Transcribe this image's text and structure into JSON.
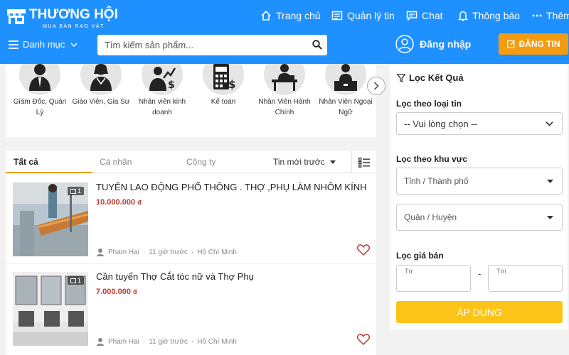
{
  "header": {
    "logo_name": "THƯƠNG HỘI",
    "logo_tagline": "MUA BÁN RAO VẶT",
    "nav": [
      {
        "label": "Trang chủ",
        "icon": "home-icon"
      },
      {
        "label": "Quản lý tin",
        "icon": "manage-posts-icon"
      },
      {
        "label": "Chat",
        "icon": "chat-icon"
      },
      {
        "label": "Thông báo",
        "icon": "bell-icon"
      },
      {
        "label": "Thêm",
        "icon": "more-icon"
      }
    ],
    "category_menu": "Danh mục",
    "search_placeholder": "Tìm kiếm sản phẩm...",
    "login": "Đăng nhập",
    "post_button": "ĐĂNG TIN",
    "brand_color": "#1e90ff",
    "accent_color": "#f39c12"
  },
  "categories": [
    {
      "label": "Giám Đốc, Quản Lý",
      "icon": "manager-icon"
    },
    {
      "label": "Giáo Viên, Gia Sư",
      "icon": "teacher-icon"
    },
    {
      "label": "Nhân viên kinh doanh",
      "icon": "sales-icon"
    },
    {
      "label": "Kế toán",
      "icon": "accountant-icon"
    },
    {
      "label": "Nhân Viên Hành Chính",
      "icon": "admin-staff-icon"
    },
    {
      "label": "Nhân Viên Ngoại Ngữ",
      "icon": "language-staff-icon"
    }
  ],
  "tabs": [
    {
      "label": "Tất cả",
      "active": true
    },
    {
      "label": "Cá nhân",
      "active": false
    },
    {
      "label": "Công ty",
      "active": false
    }
  ],
  "sort_label": "Tin mới trước",
  "listings": [
    {
      "title": "TUYỂN LAO ĐỘNG PHỔ THÔNG . THỢ ,PHỤ LÀM NHÔM KÍNH",
      "price": "10.000.000",
      "currency": "đ",
      "image_count": "1",
      "user": "Pham Hai",
      "time": "11 giờ trước",
      "location": "Hồ Chí Minh"
    },
    {
      "title": "Cần tuyển Thợ Cắt tóc nữ và Thợ Phụ",
      "price": "7.000.000",
      "currency": "đ",
      "image_count": "1",
      "user": "Pham Hai",
      "time": "11 giờ trước",
      "location": "Hồ Chí Minh"
    }
  ],
  "filter": {
    "title": "Lọc Kết Quả",
    "type_label": "Lọc theo loại tin",
    "type_value": "-- Vui lòng chọn --",
    "area_label": "Lọc theo khu vực",
    "city_value": "Tỉnh / Thành phố",
    "district_value": "Quận / Huyện",
    "price_label": "Lọc giá bán",
    "from_label": "Từ",
    "to_label": "Tới",
    "range_separator": "-",
    "apply": "ÁP DỤNG",
    "apply_color": "#fcc419"
  }
}
